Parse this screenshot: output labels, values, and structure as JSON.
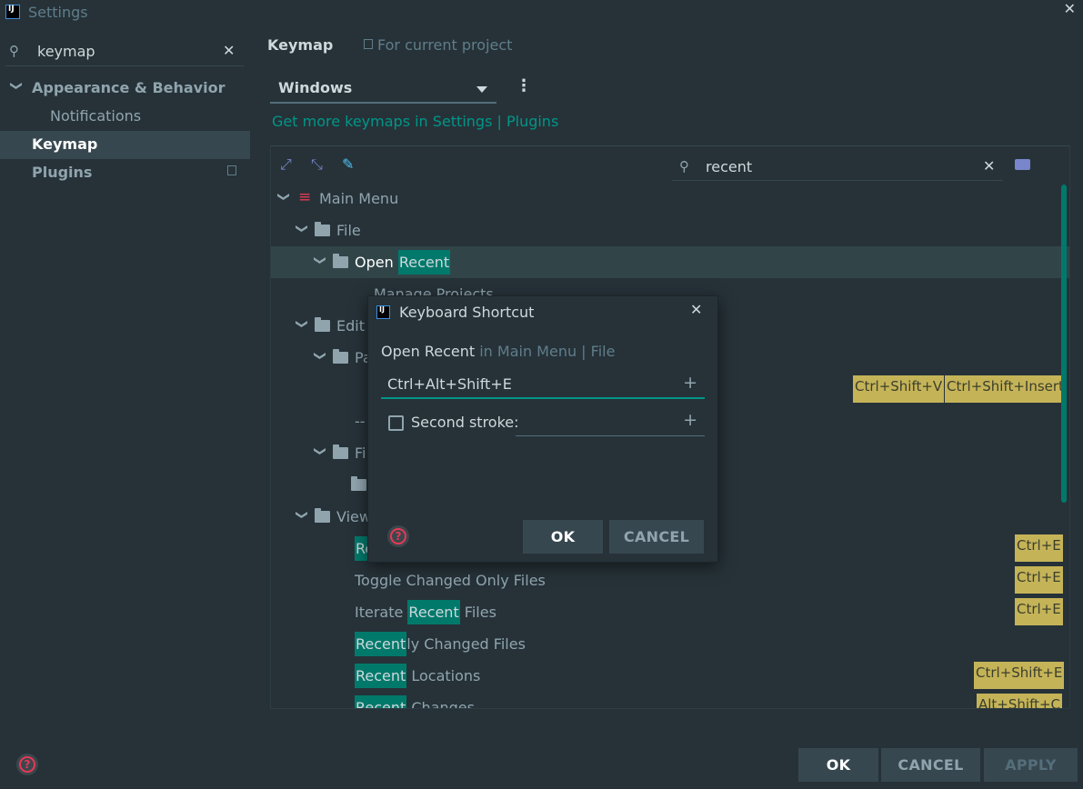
{
  "window": {
    "title": "Settings"
  },
  "sidebar": {
    "search_value": "keymap",
    "items": [
      {
        "label": "Appearance & Behavior"
      },
      {
        "label": "Notifications"
      },
      {
        "label": "Keymap"
      },
      {
        "label": "Plugins"
      }
    ]
  },
  "header": {
    "title": "Keymap",
    "scope": "For current project"
  },
  "keymap": {
    "selected": "Windows",
    "link": "Get more keymaps in Settings | Plugins",
    "search_value": "recent"
  },
  "tree": {
    "main_menu": "Main Menu",
    "file": "File",
    "open_prefix": "Open ",
    "open_hl": "Recent",
    "manage_projects": "Manage Projects",
    "edit": "Edit",
    "paste_partial": "Pa",
    "paste_sc1": "Ctrl+Shift+V",
    "paste_sc2": "Ctrl+Shift+Insert",
    "separator_partial": "--",
    "find_partial": "Fi",
    "view": "View",
    "row_re": "Re",
    "row_re_sc": "Ctrl+E",
    "toggle": "Toggle Changed Only Files",
    "toggle_sc": "Ctrl+E",
    "iterate_prefix": "Iterate ",
    "iterate_hl": "Recent",
    "iterate_suffix": " Files",
    "iterate_sc": "Ctrl+E",
    "recently_hl": "Recent",
    "recently_suffix": "ly Changed Files",
    "locations_hl": "Recent",
    "locations_suffix": " Locations",
    "locations_sc": "Ctrl+Shift+E",
    "changes_hl": "Recent",
    "changes_suffix": " Changes",
    "changes_sc": "Alt+Shift+C"
  },
  "dialog": {
    "title": "Keyboard Shortcut",
    "action": "Open Recent",
    "path": " in Main Menu | File",
    "shortcut": "Ctrl+Alt+Shift+E",
    "second_stroke_label": "Second stroke:",
    "ok": "OK",
    "cancel": "CANCEL"
  },
  "footer": {
    "ok": "OK",
    "cancel": "CANCEL",
    "apply": "APPLY"
  }
}
